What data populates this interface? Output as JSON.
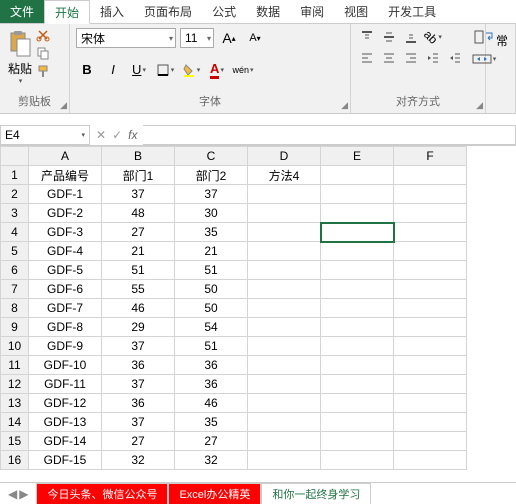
{
  "tabs": {
    "file": "文件",
    "home": "开始",
    "insert": "插入",
    "layout": "页面布局",
    "formula": "公式",
    "data": "数据",
    "review": "审阅",
    "view": "视图",
    "dev": "开发工具"
  },
  "ribbon": {
    "paste_label": "粘贴",
    "clipboard_label": "剪贴板",
    "font_label": "字体",
    "align_label": "对齐方式",
    "font_name": "宋体",
    "font_size": "11",
    "bold": "B",
    "italic": "I",
    "underline": "U",
    "grow": "A",
    "shrink": "A",
    "wen": "wén",
    "chang": "常"
  },
  "namebox": {
    "ref": "E4",
    "fx": "fx"
  },
  "columns": [
    "A",
    "B",
    "C",
    "D",
    "E",
    "F"
  ],
  "headers": {
    "c0": "产品编号",
    "c1": "部门1",
    "c2": "部门2",
    "c3": "方法4"
  },
  "rows": [
    {
      "n": "2",
      "a": "GDF-1",
      "b": "37",
      "c": "37"
    },
    {
      "n": "3",
      "a": "GDF-2",
      "b": "48",
      "c": "30"
    },
    {
      "n": "4",
      "a": "GDF-3",
      "b": "27",
      "c": "35"
    },
    {
      "n": "5",
      "a": "GDF-4",
      "b": "21",
      "c": "21"
    },
    {
      "n": "6",
      "a": "GDF-5",
      "b": "51",
      "c": "51"
    },
    {
      "n": "7",
      "a": "GDF-6",
      "b": "55",
      "c": "50"
    },
    {
      "n": "8",
      "a": "GDF-7",
      "b": "46",
      "c": "50"
    },
    {
      "n": "9",
      "a": "GDF-8",
      "b": "29",
      "c": "54"
    },
    {
      "n": "10",
      "a": "GDF-9",
      "b": "37",
      "c": "51"
    },
    {
      "n": "11",
      "a": "GDF-10",
      "b": "36",
      "c": "36"
    },
    {
      "n": "12",
      "a": "GDF-11",
      "b": "37",
      "c": "36"
    },
    {
      "n": "13",
      "a": "GDF-12",
      "b": "36",
      "c": "46"
    },
    {
      "n": "14",
      "a": "GDF-13",
      "b": "37",
      "c": "35"
    },
    {
      "n": "15",
      "a": "GDF-14",
      "b": "27",
      "c": "27"
    },
    {
      "n": "16",
      "a": "GDF-15",
      "b": "32",
      "c": "32"
    }
  ],
  "sheets": {
    "s1": "今日头条、微信公众号",
    "s2": "Excel办公精英",
    "s3": "和你一起终身学习"
  }
}
